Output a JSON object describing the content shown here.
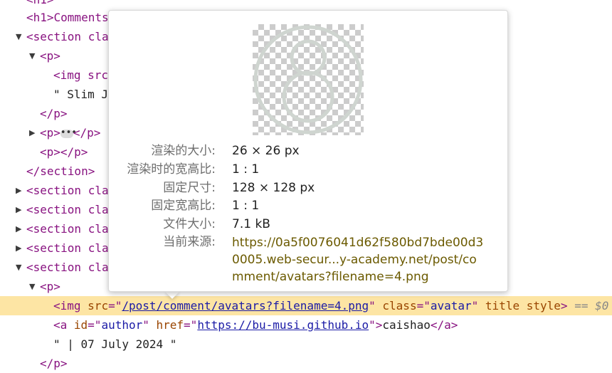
{
  "dom_tree": {
    "row_h1": "<h1>Comments</h1>",
    "row_h1_top": "<h1>",
    "section_open": "<section cla",
    "p_open": "<p>",
    "img_open": "<img src=",
    "slim_text": "\" Slim Ji",
    "p_close": "</p>",
    "p_collapsed_open": "<p>",
    "p_collapsed_close": "</p>",
    "ellipsis": "•••",
    "p_empty": "<p></p>",
    "section_close": "</section>",
    "sections_collapsed": [
      "<section cla",
      "<section cla",
      "<section cla",
      "<section cla"
    ],
    "section_expanded": "<section cla",
    "p_open_2": "<p>",
    "selected_img": {
      "open": "<img",
      "src_attr": "src",
      "src_eq": "=\"",
      "src_val": "/post/comment/avatars?filename=4.png",
      "src_close": "\"",
      "class_attr": "class",
      "class_eq": "=\"",
      "class_val": "avatar",
      "class_close": "\"",
      "title_attr": "title",
      "style_attr": "style",
      "close": ">",
      "ref": "== $0"
    },
    "author_link": {
      "open": "<a",
      "id_attr": "id",
      "id_eq": "=\"",
      "id_val": "author",
      "id_close": "\"",
      "href_attr": "href",
      "href_eq": "=\"",
      "href_val": "https://bu-musi.github.io",
      "href_close": "\">",
      "text": "caishao",
      "close": "</a>"
    },
    "date_text": "\" | 07 July 2024 \"",
    "p_close_2": "</p>"
  },
  "image_popup": {
    "labels": {
      "rendered_size": "渲染的大小:",
      "rendered_ratio": "渲染时的宽高比:",
      "intrinsic_size": "固定尺寸:",
      "intrinsic_ratio": "固定宽高比:",
      "file_size": "文件大小:",
      "current_source": "当前来源:"
    },
    "values": {
      "rendered_size": "26 × 26 px",
      "rendered_ratio": "1 : 1",
      "intrinsic_size": "128 × 128 px",
      "intrinsic_ratio": "1 : 1",
      "file_size": "7.1 kB"
    },
    "source_lines": [
      "https://0a5f0076041d62f580bd7bde00d3",
      "0005.web-secur...y-academy.net/post/co",
      "mment/avatars?filename=4.png"
    ]
  },
  "colors": {
    "selected_row": "#fde5a4",
    "tag": "#881280",
    "attribute": "#994500",
    "attribute_value": "#1a1aa6",
    "source_link": "#6b5a00"
  },
  "icons": [
    "triangle-expanded-icon",
    "triangle-collapsed-icon",
    "ellipsis-icon",
    "avatar-thumbnail"
  ]
}
